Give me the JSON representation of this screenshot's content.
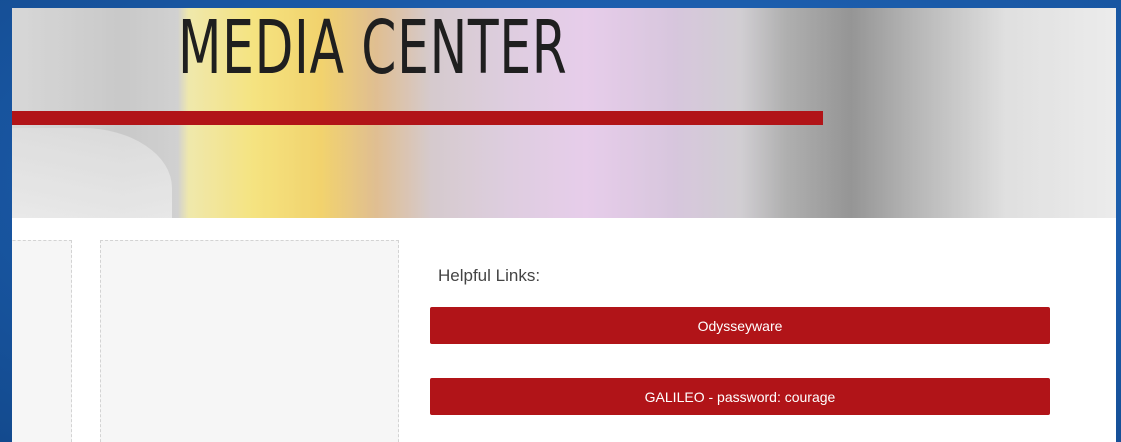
{
  "hero": {
    "title": "MEDIA CENTER",
    "accent_color": "#b11418"
  },
  "links": {
    "heading": "Helpful Links:",
    "items": [
      {
        "label": "Odysseyware"
      },
      {
        "label": "GALILEO - password: courage"
      }
    ]
  },
  "colors": {
    "button_bg": "#b11418",
    "button_text": "#ffffff",
    "page_bg": "#ffffff",
    "outer_bg": "#1a5aa8"
  }
}
